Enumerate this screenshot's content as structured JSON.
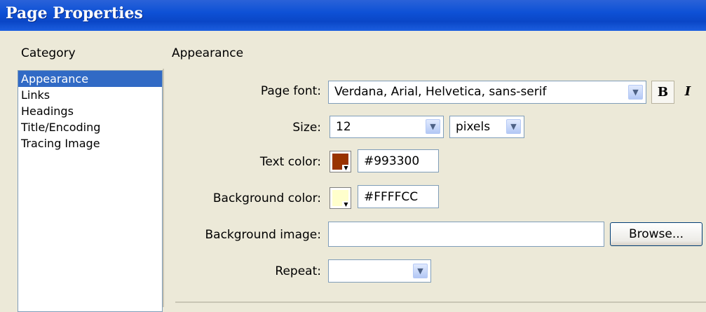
{
  "window": {
    "title": "Page Properties"
  },
  "category": {
    "heading": "Category",
    "items": [
      "Appearance",
      "Links",
      "Headings",
      "Title/Encoding",
      "Tracing Image"
    ],
    "selected": "Appearance"
  },
  "section": {
    "heading": "Appearance"
  },
  "form": {
    "page_font": {
      "label": "Page font:",
      "value": "Verdana, Arial, Helvetica, sans-serif"
    },
    "bold_label": "B",
    "italic_label": "I",
    "size": {
      "label": "Size:",
      "value": "12",
      "unit": "pixels"
    },
    "text_color": {
      "label": "Text color:",
      "value": "#993300",
      "swatch": "#993300"
    },
    "background_color": {
      "label": "Background color:",
      "value": "#FFFFCC",
      "swatch": "#FFFFCC"
    },
    "background_image": {
      "label": "Background image:",
      "value": "",
      "browse_label": "Browse..."
    },
    "repeat": {
      "label": "Repeat:",
      "value": ""
    }
  },
  "icons": {
    "dropdown": "chevron-down-icon",
    "swatch_arrow": "triangle-down-icon"
  }
}
